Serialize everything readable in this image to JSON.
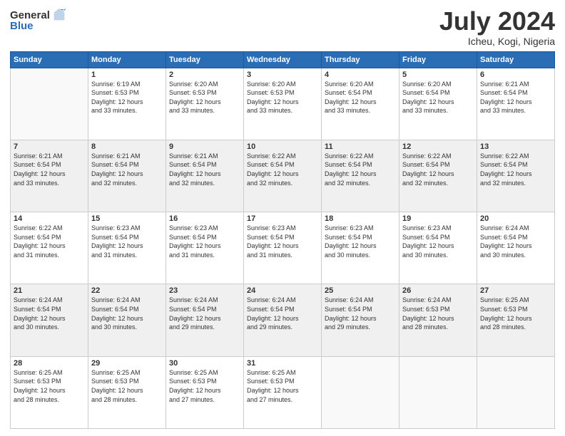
{
  "header": {
    "logo_general": "General",
    "logo_blue": "Blue",
    "title": "July 2024",
    "location": "Icheu, Kogi, Nigeria"
  },
  "days_of_week": [
    "Sunday",
    "Monday",
    "Tuesday",
    "Wednesday",
    "Thursday",
    "Friday",
    "Saturday"
  ],
  "weeks": [
    [
      {
        "day": "",
        "info": ""
      },
      {
        "day": "1",
        "info": "Sunrise: 6:19 AM\nSunset: 6:53 PM\nDaylight: 12 hours\nand 33 minutes."
      },
      {
        "day": "2",
        "info": "Sunrise: 6:20 AM\nSunset: 6:53 PM\nDaylight: 12 hours\nand 33 minutes."
      },
      {
        "day": "3",
        "info": "Sunrise: 6:20 AM\nSunset: 6:53 PM\nDaylight: 12 hours\nand 33 minutes."
      },
      {
        "day": "4",
        "info": "Sunrise: 6:20 AM\nSunset: 6:54 PM\nDaylight: 12 hours\nand 33 minutes."
      },
      {
        "day": "5",
        "info": "Sunrise: 6:20 AM\nSunset: 6:54 PM\nDaylight: 12 hours\nand 33 minutes."
      },
      {
        "day": "6",
        "info": "Sunrise: 6:21 AM\nSunset: 6:54 PM\nDaylight: 12 hours\nand 33 minutes."
      }
    ],
    [
      {
        "day": "7",
        "info": "Sunrise: 6:21 AM\nSunset: 6:54 PM\nDaylight: 12 hours\nand 33 minutes."
      },
      {
        "day": "8",
        "info": "Sunrise: 6:21 AM\nSunset: 6:54 PM\nDaylight: 12 hours\nand 32 minutes."
      },
      {
        "day": "9",
        "info": "Sunrise: 6:21 AM\nSunset: 6:54 PM\nDaylight: 12 hours\nand 32 minutes."
      },
      {
        "day": "10",
        "info": "Sunrise: 6:22 AM\nSunset: 6:54 PM\nDaylight: 12 hours\nand 32 minutes."
      },
      {
        "day": "11",
        "info": "Sunrise: 6:22 AM\nSunset: 6:54 PM\nDaylight: 12 hours\nand 32 minutes."
      },
      {
        "day": "12",
        "info": "Sunrise: 6:22 AM\nSunset: 6:54 PM\nDaylight: 12 hours\nand 32 minutes."
      },
      {
        "day": "13",
        "info": "Sunrise: 6:22 AM\nSunset: 6:54 PM\nDaylight: 12 hours\nand 32 minutes."
      }
    ],
    [
      {
        "day": "14",
        "info": "Sunrise: 6:22 AM\nSunset: 6:54 PM\nDaylight: 12 hours\nand 31 minutes."
      },
      {
        "day": "15",
        "info": "Sunrise: 6:23 AM\nSunset: 6:54 PM\nDaylight: 12 hours\nand 31 minutes."
      },
      {
        "day": "16",
        "info": "Sunrise: 6:23 AM\nSunset: 6:54 PM\nDaylight: 12 hours\nand 31 minutes."
      },
      {
        "day": "17",
        "info": "Sunrise: 6:23 AM\nSunset: 6:54 PM\nDaylight: 12 hours\nand 31 minutes."
      },
      {
        "day": "18",
        "info": "Sunrise: 6:23 AM\nSunset: 6:54 PM\nDaylight: 12 hours\nand 30 minutes."
      },
      {
        "day": "19",
        "info": "Sunrise: 6:23 AM\nSunset: 6:54 PM\nDaylight: 12 hours\nand 30 minutes."
      },
      {
        "day": "20",
        "info": "Sunrise: 6:24 AM\nSunset: 6:54 PM\nDaylight: 12 hours\nand 30 minutes."
      }
    ],
    [
      {
        "day": "21",
        "info": "Sunrise: 6:24 AM\nSunset: 6:54 PM\nDaylight: 12 hours\nand 30 minutes."
      },
      {
        "day": "22",
        "info": "Sunrise: 6:24 AM\nSunset: 6:54 PM\nDaylight: 12 hours\nand 30 minutes."
      },
      {
        "day": "23",
        "info": "Sunrise: 6:24 AM\nSunset: 6:54 PM\nDaylight: 12 hours\nand 29 minutes."
      },
      {
        "day": "24",
        "info": "Sunrise: 6:24 AM\nSunset: 6:54 PM\nDaylight: 12 hours\nand 29 minutes."
      },
      {
        "day": "25",
        "info": "Sunrise: 6:24 AM\nSunset: 6:54 PM\nDaylight: 12 hours\nand 29 minutes."
      },
      {
        "day": "26",
        "info": "Sunrise: 6:24 AM\nSunset: 6:53 PM\nDaylight: 12 hours\nand 28 minutes."
      },
      {
        "day": "27",
        "info": "Sunrise: 6:25 AM\nSunset: 6:53 PM\nDaylight: 12 hours\nand 28 minutes."
      }
    ],
    [
      {
        "day": "28",
        "info": "Sunrise: 6:25 AM\nSunset: 6:53 PM\nDaylight: 12 hours\nand 28 minutes."
      },
      {
        "day": "29",
        "info": "Sunrise: 6:25 AM\nSunset: 6:53 PM\nDaylight: 12 hours\nand 28 minutes."
      },
      {
        "day": "30",
        "info": "Sunrise: 6:25 AM\nSunset: 6:53 PM\nDaylight: 12 hours\nand 27 minutes."
      },
      {
        "day": "31",
        "info": "Sunrise: 6:25 AM\nSunset: 6:53 PM\nDaylight: 12 hours\nand 27 minutes."
      },
      {
        "day": "",
        "info": ""
      },
      {
        "day": "",
        "info": ""
      },
      {
        "day": "",
        "info": ""
      }
    ]
  ]
}
